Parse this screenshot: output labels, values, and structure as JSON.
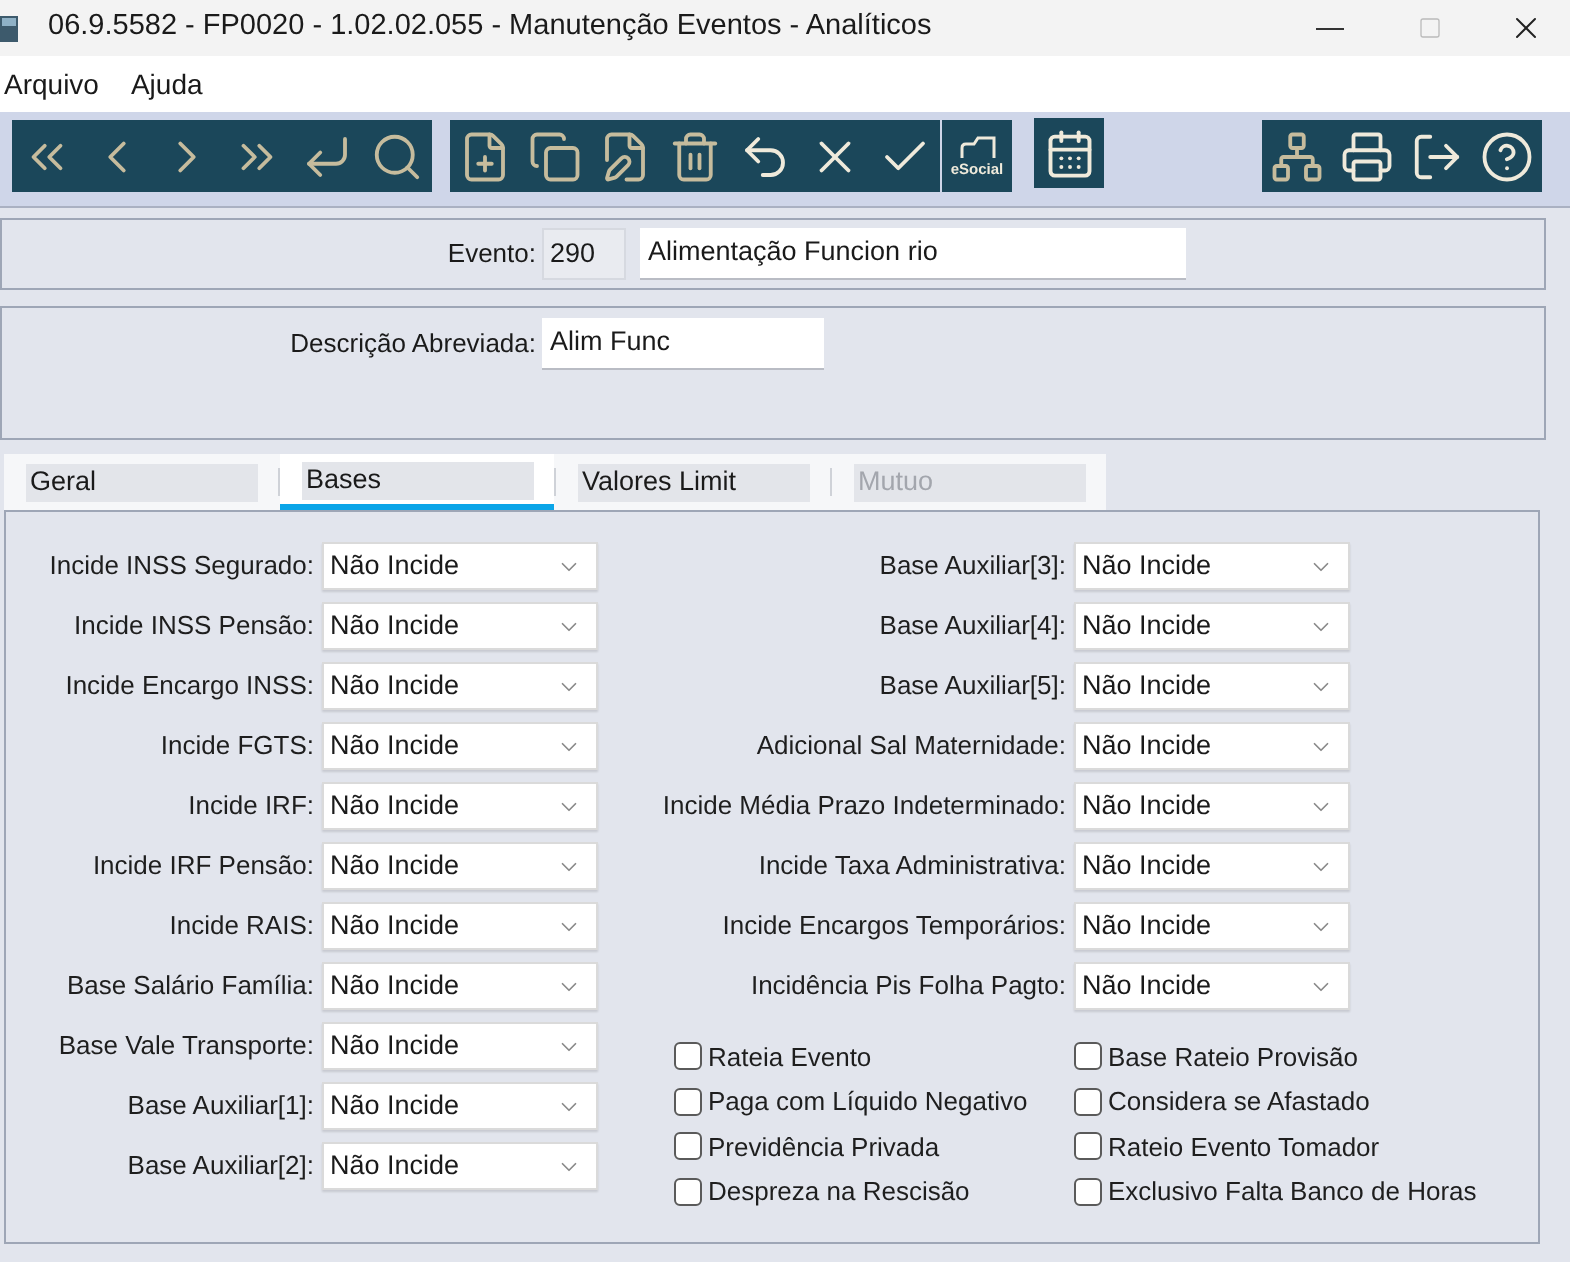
{
  "window": {
    "title": "06.9.5582 - FP0020 - 1.02.02.055 - Manutenção Eventos - Analíticos"
  },
  "menu": [
    {
      "label": "Arquivo"
    },
    {
      "label": "Ajuda"
    }
  ],
  "toolbar": {
    "esocial_label": "eSocial"
  },
  "evento": {
    "label": "Evento:",
    "code": "290",
    "name": "Alimentação Funcion rio"
  },
  "descricao": {
    "label": "Descrição Abreviada:",
    "value": "Alim Func"
  },
  "tabs": [
    {
      "label": "Geral",
      "selected": false,
      "disabled": false
    },
    {
      "label": "Bases",
      "selected": true,
      "disabled": false
    },
    {
      "label": "Valores Limit",
      "selected": false,
      "disabled": false
    },
    {
      "label": "Mutuo",
      "selected": false,
      "disabled": true
    }
  ],
  "left_fields": [
    {
      "label": "Incide INSS Segurado:",
      "value": "Não Incide"
    },
    {
      "label": "Incide INSS Pensão:",
      "value": "Não Incide"
    },
    {
      "label": "Incide Encargo INSS:",
      "value": "Não Incide"
    },
    {
      "label": "Incide FGTS:",
      "value": "Não Incide"
    },
    {
      "label": "Incide IRF:",
      "value": "Não Incide"
    },
    {
      "label": "Incide IRF Pensão:",
      "value": "Não Incide"
    },
    {
      "label": "Incide RAIS:",
      "value": "Não Incide"
    },
    {
      "label": "Base Salário Família:",
      "value": "Não Incide"
    },
    {
      "label": "Base Vale Transporte:",
      "value": "Não Incide"
    },
    {
      "label": "Base Auxiliar[1]:",
      "value": "Não Incide"
    },
    {
      "label": "Base Auxiliar[2]:",
      "value": "Não Incide"
    }
  ],
  "right_fields": [
    {
      "label": "Base Auxiliar[3]:",
      "value": "Não Incide"
    },
    {
      "label": "Base Auxiliar[4]:",
      "value": "Não Incide"
    },
    {
      "label": "Base Auxiliar[5]:",
      "value": "Não Incide"
    },
    {
      "label": "Adicional Sal Maternidade:",
      "value": "Não Incide"
    },
    {
      "label": "Incide Média Prazo Indeterminado:",
      "value": "Não Incide"
    },
    {
      "label": "Incide Taxa Administrativa:",
      "value": "Não Incide"
    },
    {
      "label": "Incide Encargos Temporários:",
      "value": "Não Incide"
    },
    {
      "label": "Incidência Pis Folha Pagto:",
      "value": "Não Incide"
    }
  ],
  "checkboxes_left": [
    {
      "label": "Rateia Evento",
      "checked": false
    },
    {
      "label": "Paga com Líquido Negativo",
      "checked": false
    },
    {
      "label": "Previdência Privada",
      "checked": false
    },
    {
      "label": "Despreza na Rescisão",
      "checked": false
    }
  ],
  "checkboxes_right": [
    {
      "label": "Base Rateio Provisão",
      "checked": false
    },
    {
      "label": "Considera se Afastado",
      "checked": false
    },
    {
      "label": "Rateio Evento Tomador",
      "checked": false
    },
    {
      "label": "Exclusivo Falta Banco de Horas",
      "checked": false
    }
  ]
}
